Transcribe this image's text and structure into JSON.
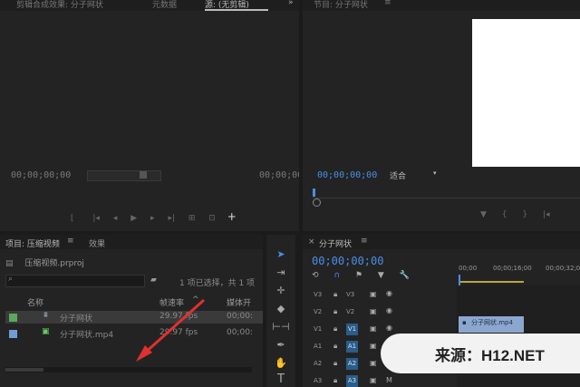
{
  "source_panel": {
    "tabs": [
      "剪辑合成效果: 分子网状",
      "元数据",
      "源: (无剪辑)"
    ],
    "timecode_left": "00;00;00;00",
    "timecode_right": "00;00;00"
  },
  "program_panel": {
    "title": "节目: 分子网状",
    "timecode": "00;00;00;00",
    "fit_label": "适合"
  },
  "project_panel": {
    "tab_project": "项目: 压缩视频",
    "tab_effects": "效果",
    "file_name": "压缩视频.prproj",
    "selection_info": "1 项已选择，共 1 项",
    "columns": {
      "name": "名称",
      "fps": "帧速率",
      "media_start": "媒体开"
    },
    "rows": [
      {
        "name": "分子网状",
        "fps": "29.97 fps",
        "start": "00;00:"
      },
      {
        "name": "分子网状.mp4",
        "fps": "29.97 fps",
        "start": "00;00:"
      }
    ]
  },
  "timeline": {
    "title": "分子网状",
    "timecode": "00;00;00;00",
    "ruler": [
      "00;00",
      "00;00;16;00",
      "00;00;32;0"
    ],
    "tracks": [
      {
        "name": "V3",
        "target": "V3"
      },
      {
        "name": "V2",
        "target": "V2"
      },
      {
        "name": "V1",
        "target": "V1"
      },
      {
        "name": "A1",
        "target": "A1"
      },
      {
        "name": "A2",
        "target": "A2"
      },
      {
        "name": "A3",
        "target": "A3"
      }
    ],
    "clip_label": "分子网状.mp4",
    "clip_color": "#8ba7d0"
  },
  "watermark": {
    "text": "来源：H12.NET"
  },
  "colors": {
    "accent": "#4a8ee6",
    "selection": "#3a3a3a",
    "arrow": "#e03030"
  }
}
